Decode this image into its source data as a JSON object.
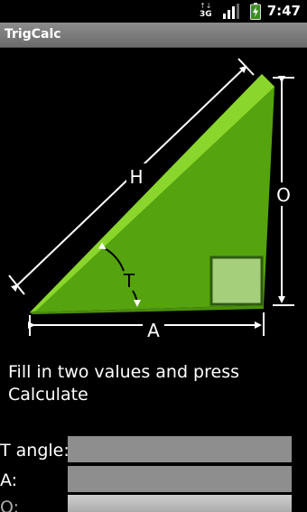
{
  "status_bar": {
    "network": "3G",
    "network_arrows": "↑↓",
    "time": "7:47"
  },
  "app": {
    "title": "TrigCalc"
  },
  "diagram": {
    "hypotenuse_label": "H",
    "opposite_label": "O",
    "adjacent_label": "A",
    "angle_label": "T",
    "colors": {
      "triangle_fill": "#55a30e",
      "triangle_edge": "#8ad62c",
      "right_angle_fill": "#a6cf7c",
      "right_angle_border": "#2e5c10",
      "arrow": "#ffffff"
    }
  },
  "instruction": "Fill in two values and press Calculate",
  "form": {
    "t_angle_label": "T angle:",
    "a_label": "A:",
    "o_label": "O:",
    "t_angle_value": "",
    "a_value": "",
    "o_value": ""
  }
}
